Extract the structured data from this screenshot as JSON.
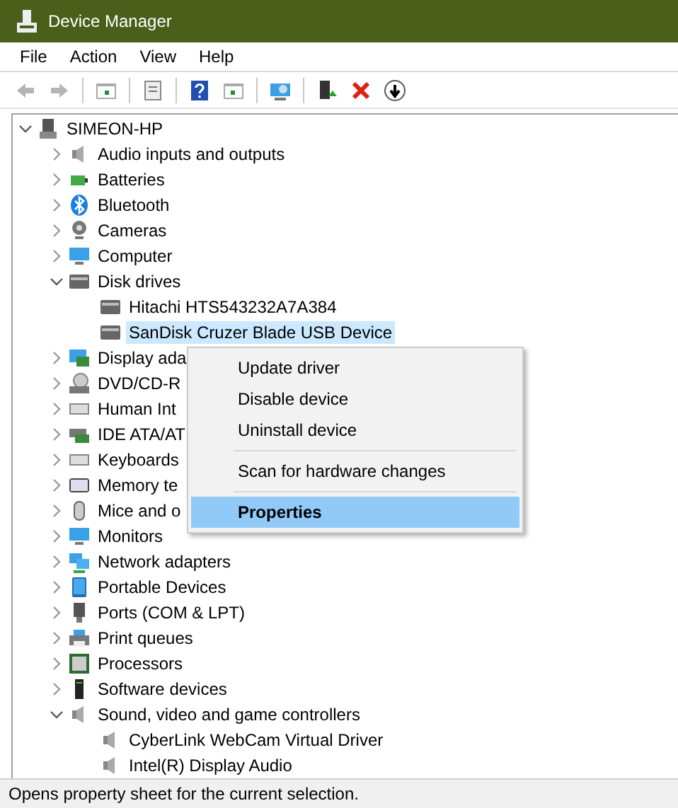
{
  "window": {
    "title": "Device Manager"
  },
  "menu": [
    "File",
    "Action",
    "View",
    "Help"
  ],
  "toolbar": [
    {
      "kind": "back",
      "disabled": true
    },
    {
      "kind": "forward",
      "disabled": true
    },
    {
      "kind": "sep"
    },
    {
      "kind": "console",
      "disabled": false
    },
    {
      "kind": "sep"
    },
    {
      "kind": "sheet",
      "disabled": false
    },
    {
      "kind": "sep"
    },
    {
      "kind": "help",
      "disabled": false
    },
    {
      "kind": "pane",
      "disabled": false
    },
    {
      "kind": "sep"
    },
    {
      "kind": "scan",
      "disabled": false
    },
    {
      "kind": "sep"
    },
    {
      "kind": "update",
      "disabled": false
    },
    {
      "kind": "remove",
      "disabled": false
    },
    {
      "kind": "download",
      "disabled": false
    }
  ],
  "tree": {
    "label": "SIMEON-HP",
    "expanded": true,
    "selected": false,
    "children": [
      {
        "label": "Audio inputs and outputs",
        "expanded": false,
        "selected": false,
        "kind": "speaker"
      },
      {
        "label": "Batteries",
        "expanded": false,
        "selected": false,
        "kind": "battery"
      },
      {
        "label": "Bluetooth",
        "expanded": false,
        "selected": false,
        "kind": "bluetooth"
      },
      {
        "label": "Cameras",
        "expanded": false,
        "selected": false,
        "kind": "camera"
      },
      {
        "label": "Computer",
        "expanded": false,
        "selected": false,
        "kind": "monitor"
      },
      {
        "label": "Disk drives",
        "expanded": true,
        "selected": false,
        "kind": "drive",
        "children": [
          {
            "label": "Hitachi HTS543232A7A384",
            "selected": false,
            "kind": "drive"
          },
          {
            "label": "SanDisk Cruzer Blade USB Device",
            "selected": true,
            "kind": "drive"
          }
        ]
      },
      {
        "label": "Display ada",
        "expanded": false,
        "selected": false,
        "kind": "display"
      },
      {
        "label": "DVD/CD-R",
        "expanded": false,
        "selected": false,
        "kind": "disc"
      },
      {
        "label": "Human Int",
        "expanded": false,
        "selected": false,
        "kind": "keyboard"
      },
      {
        "label": "IDE ATA/AT",
        "expanded": false,
        "selected": false,
        "kind": "card"
      },
      {
        "label": "Keyboards",
        "expanded": false,
        "selected": false,
        "kind": "keyboard"
      },
      {
        "label": "Memory te",
        "expanded": false,
        "selected": false,
        "kind": "memory"
      },
      {
        "label": "Mice and o",
        "expanded": false,
        "selected": false,
        "kind": "mouse"
      },
      {
        "label": "Monitors",
        "expanded": false,
        "selected": false,
        "kind": "monitor"
      },
      {
        "label": "Network adapters",
        "expanded": false,
        "selected": false,
        "kind": "network"
      },
      {
        "label": "Portable Devices",
        "expanded": false,
        "selected": false,
        "kind": "portable"
      },
      {
        "label": "Ports (COM & LPT)",
        "expanded": false,
        "selected": false,
        "kind": "port"
      },
      {
        "label": "Print queues",
        "expanded": false,
        "selected": false,
        "kind": "printer"
      },
      {
        "label": "Processors",
        "expanded": false,
        "selected": false,
        "kind": "chip"
      },
      {
        "label": "Software devices",
        "expanded": false,
        "selected": false,
        "kind": "tower"
      },
      {
        "label": "Sound, video and game controllers",
        "expanded": true,
        "selected": false,
        "kind": "speaker",
        "children": [
          {
            "label": "CyberLink WebCam Virtual Driver",
            "selected": false,
            "kind": "speaker"
          },
          {
            "label": "Intel(R) Display Audio",
            "selected": false,
            "kind": "speaker"
          }
        ]
      }
    ]
  },
  "context_menu": [
    {
      "kind": "item",
      "label": "Update driver",
      "selected": false
    },
    {
      "kind": "item",
      "label": "Disable device",
      "selected": false
    },
    {
      "kind": "item",
      "label": "Uninstall device",
      "selected": false
    },
    {
      "kind": "separator"
    },
    {
      "kind": "item",
      "label": "Scan for hardware changes",
      "selected": false
    },
    {
      "kind": "separator"
    },
    {
      "kind": "item",
      "label": "Properties",
      "selected": true,
      "bold": true
    }
  ],
  "status_bar": "Opens property sheet for the current selection."
}
